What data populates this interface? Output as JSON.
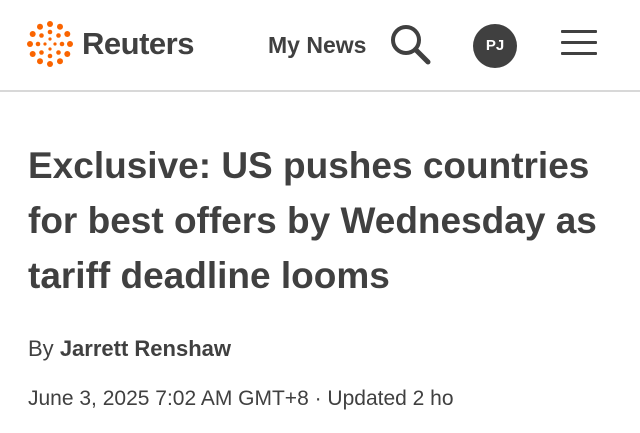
{
  "header": {
    "logo_text": "Reuters",
    "my_news_label": "My News",
    "avatar_initials": "PJ",
    "icons": [
      "reuters-logo-icon",
      "search-icon",
      "menu-icon"
    ]
  },
  "article": {
    "headline": "Exclusive: US pushes countries for best offers by Wednesday as tariff deadline looms",
    "byline_prefix": "By",
    "author": "Jarrett Renshaw",
    "dateline": "June 3, 2025 7:02 AM GMT+8 · Updated 2 ho"
  },
  "colors": {
    "text": "#404040",
    "brand_orange": "#fa6400",
    "divider": "#d8d8d8"
  }
}
